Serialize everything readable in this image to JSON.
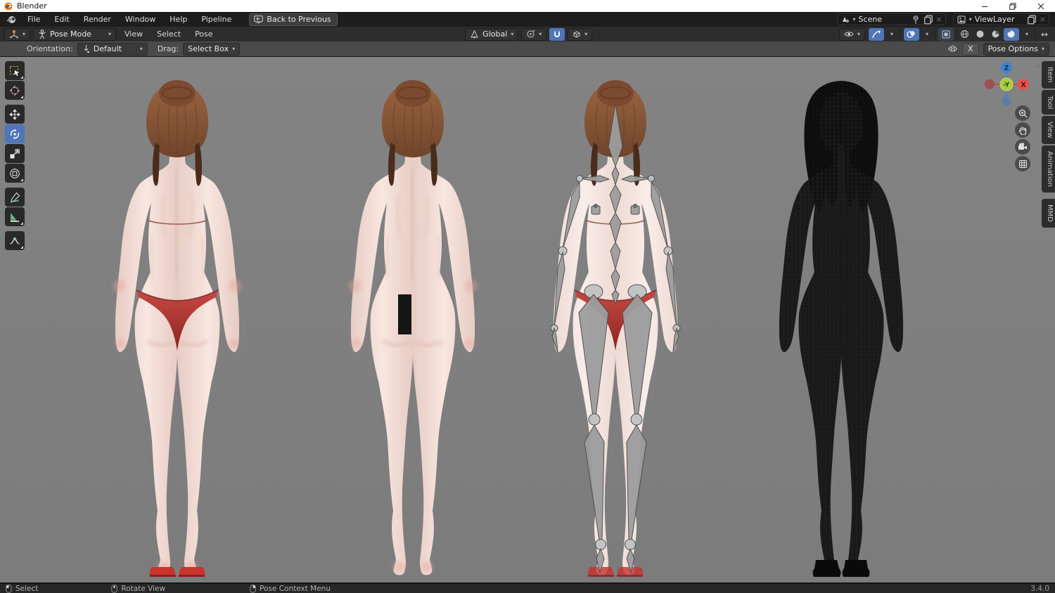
{
  "window": {
    "title": "Blender"
  },
  "menubar": {
    "items": [
      "File",
      "Edit",
      "Render",
      "Window",
      "Help",
      "Pipeline"
    ],
    "back_button": "Back to Previous",
    "scene_value": "Scene",
    "viewlayer_value": "ViewLayer"
  },
  "header": {
    "mode": "Pose Mode",
    "menus": [
      "View",
      "Select",
      "Pose"
    ],
    "orientation": "Global"
  },
  "tool_settings": {
    "orientation_label": "Orientation:",
    "orientation_value": "Default",
    "drag_label": "Drag:",
    "drag_value": "Select Box",
    "mirror_x_label": "X",
    "pose_options_label": "Pose Options"
  },
  "viewport": {
    "models": [
      "shaded-model-bikini",
      "shaded-model-censored",
      "model-with-armature-overlay",
      "wireframe-model"
    ],
    "gizmo": {
      "z": "Z",
      "x": "X",
      "y_center": "-Y"
    },
    "sidebar_tabs": [
      "Item",
      "Tool",
      "View",
      "Animation",
      "MMD"
    ],
    "tools": [
      "tweak-select",
      "cursor",
      "move",
      "rotate",
      "scale",
      "transform",
      "annotate",
      "measure",
      "pose-breakdowner"
    ]
  },
  "status_bar": {
    "items": [
      {
        "label": "Select"
      },
      {
        "label": "Rotate View"
      },
      {
        "label": "Pose Context Menu"
      }
    ],
    "version": "3.4.0"
  },
  "colors": {
    "accent_blue": "#4f76b8",
    "axis_x_red": "#e5504a",
    "axis_z_blue": "#3f83d2",
    "axis_y_green": "#a8cc3b",
    "viewport_gray": "#7f7f7f",
    "skin": "#f2dcd6",
    "hair_brown": "#8a573a",
    "bikini_red": "#b03434"
  }
}
